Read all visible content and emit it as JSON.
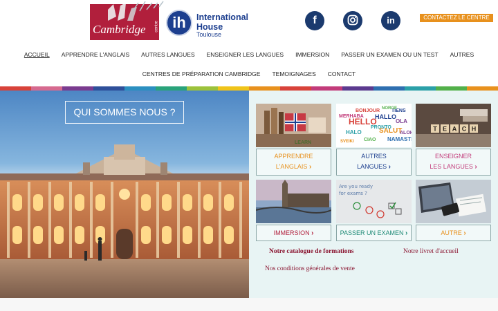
{
  "header": {
    "cambridge_logo_text": "Cambridge",
    "cambridge_logo_small": "centre",
    "ih_line1": "International",
    "ih_line2": "House",
    "ih_line3": "Toulouse",
    "ih_mark": "ih",
    "contact_label": "CONTACTEZ LE CENTRE",
    "social": [
      {
        "name": "facebook-icon",
        "glyph": "f",
        "color": "#1b3a6e"
      },
      {
        "name": "instagram-icon",
        "glyph": "",
        "color": "#1b3a6e"
      },
      {
        "name": "linkedin-icon",
        "glyph": "in",
        "color": "#1b3a6e"
      }
    ]
  },
  "nav": {
    "row1": [
      "ACCUEIL",
      "APPRENDRE L'ANGLAIS",
      "AUTRES LANGUES",
      "ENSEIGNER LES LANGUES",
      "IMMERSION",
      "PASSER UN EXAMEN OU UN TEST",
      "AUTRES"
    ],
    "row2": [
      "CENTRES DE PRÉPARATION CAMBRIDGE",
      "TEMOIGNAGES",
      "CONTACT"
    ],
    "active": "ACCUEIL"
  },
  "rainbow": [
    "#d8423a",
    "#d66a8f",
    "#7a3b8f",
    "#2e4f9a",
    "#2b8fc0",
    "#29a37a",
    "#9cc23b",
    "#f0c419",
    "#e8911d",
    "#d8423a",
    "#c23b7a",
    "#5b3a8f",
    "#2e6fb0",
    "#2ba0a8",
    "#52b04a",
    "#e8911d"
  ],
  "hero": {
    "heading": "QUI SOMMES NOUS ?"
  },
  "tiles": [
    {
      "line1": "APPRENDRE",
      "line2": "L'ANGLAIS",
      "color": "#e8911d",
      "img": "books-flag"
    },
    {
      "line1": "AUTRES",
      "line2": "LANGUES",
      "color": "#1d3f8f",
      "img": "word-cloud"
    },
    {
      "line1": "ENSEIGNER",
      "line2": "LES LANGUES",
      "color": "#c23b7a",
      "img": "teach-blocks"
    },
    {
      "line1": "IMMERSION",
      "line2": "",
      "color": "#b11f3c",
      "img": "london"
    },
    {
      "line1": "PASSER UN EXAMEN",
      "line2": "",
      "color": "#1e8a76",
      "img": "exam"
    },
    {
      "line1": "AUTRE",
      "line2": "",
      "color": "#e8911d",
      "img": "laptop"
    }
  ],
  "word_cloud": [
    "HELLO",
    "HALLO",
    "HALO",
    "SALUT",
    "OLA",
    "CIAO",
    "MERHABA",
    "NAMASTE",
    "BONJOUR",
    "TIENS",
    "PRONTO",
    "SVEIKI",
    "ALOHA",
    "NORGE"
  ],
  "teach_text": "TEACH",
  "exam_text": "Are you ready for exams ?",
  "links": {
    "catalogue": "Notre catalogue de formations",
    "livret": "Notre livret d'accueil",
    "conditions": "Nos conditions générales de vente"
  },
  "colors": {
    "catalogue": "#8a1430",
    "livret": "#8a1430",
    "conditions": "#8a1430"
  }
}
